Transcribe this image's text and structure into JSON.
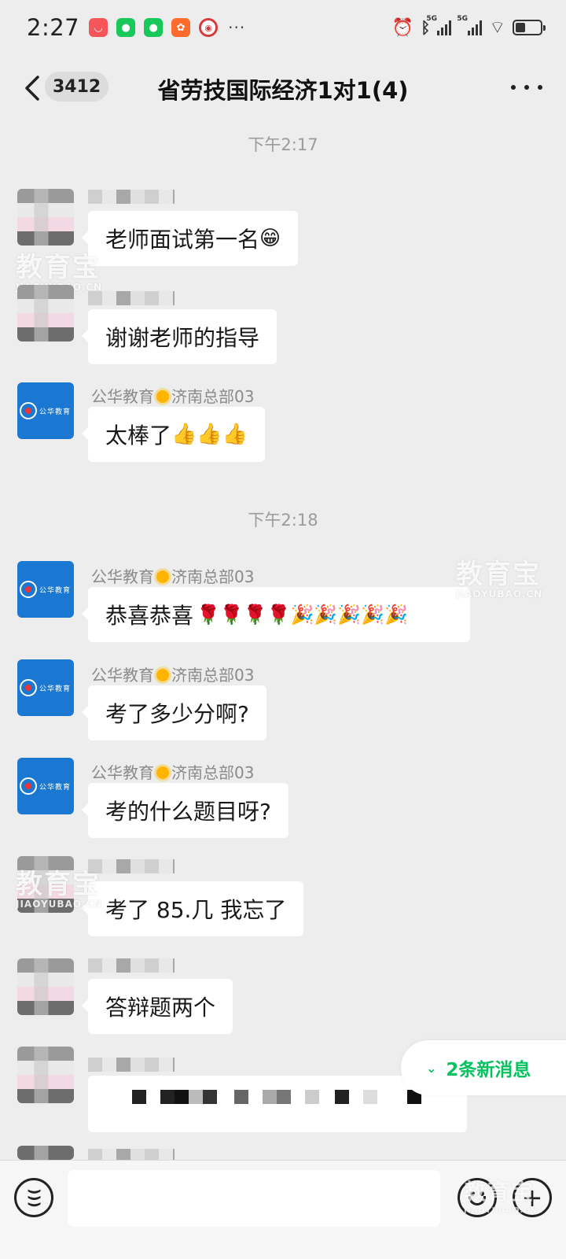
{
  "status_bar": {
    "time": "2:27",
    "more": "···",
    "network_label": "5G"
  },
  "header": {
    "unread_count": "3412",
    "title": "省劳技国际经济1对1(4)"
  },
  "timestamps": [
    "下午2:17",
    "下午2:18"
  ],
  "sender_org": {
    "name_prefix": "公华教育",
    "name_suffix": "济南总部03",
    "logo_text": "公华教育"
  },
  "messages": [
    {
      "text": "老师面试第一名",
      "emoji": "😁"
    },
    {
      "text": "谢谢老师的指导",
      "emoji": ""
    },
    {
      "text": "太棒了",
      "emoji": "👍👍👍"
    },
    {
      "text": "恭喜恭喜",
      "emoji": "🌹🌹🌹🌹🎉🎉🎉🎉🎉"
    },
    {
      "text": "考了多少分啊?",
      "emoji": ""
    },
    {
      "text": "考的什么题目呀?",
      "emoji": ""
    },
    {
      "text": "考了 85.几 我忘了",
      "emoji": ""
    },
    {
      "text": "答辩题两个",
      "emoji": ""
    }
  ],
  "watermark": {
    "big": "教育宝",
    "small": "JIAOYUBAO.CN"
  },
  "new_messages": {
    "label": "2条新消息"
  },
  "input": {
    "placeholder": ""
  }
}
